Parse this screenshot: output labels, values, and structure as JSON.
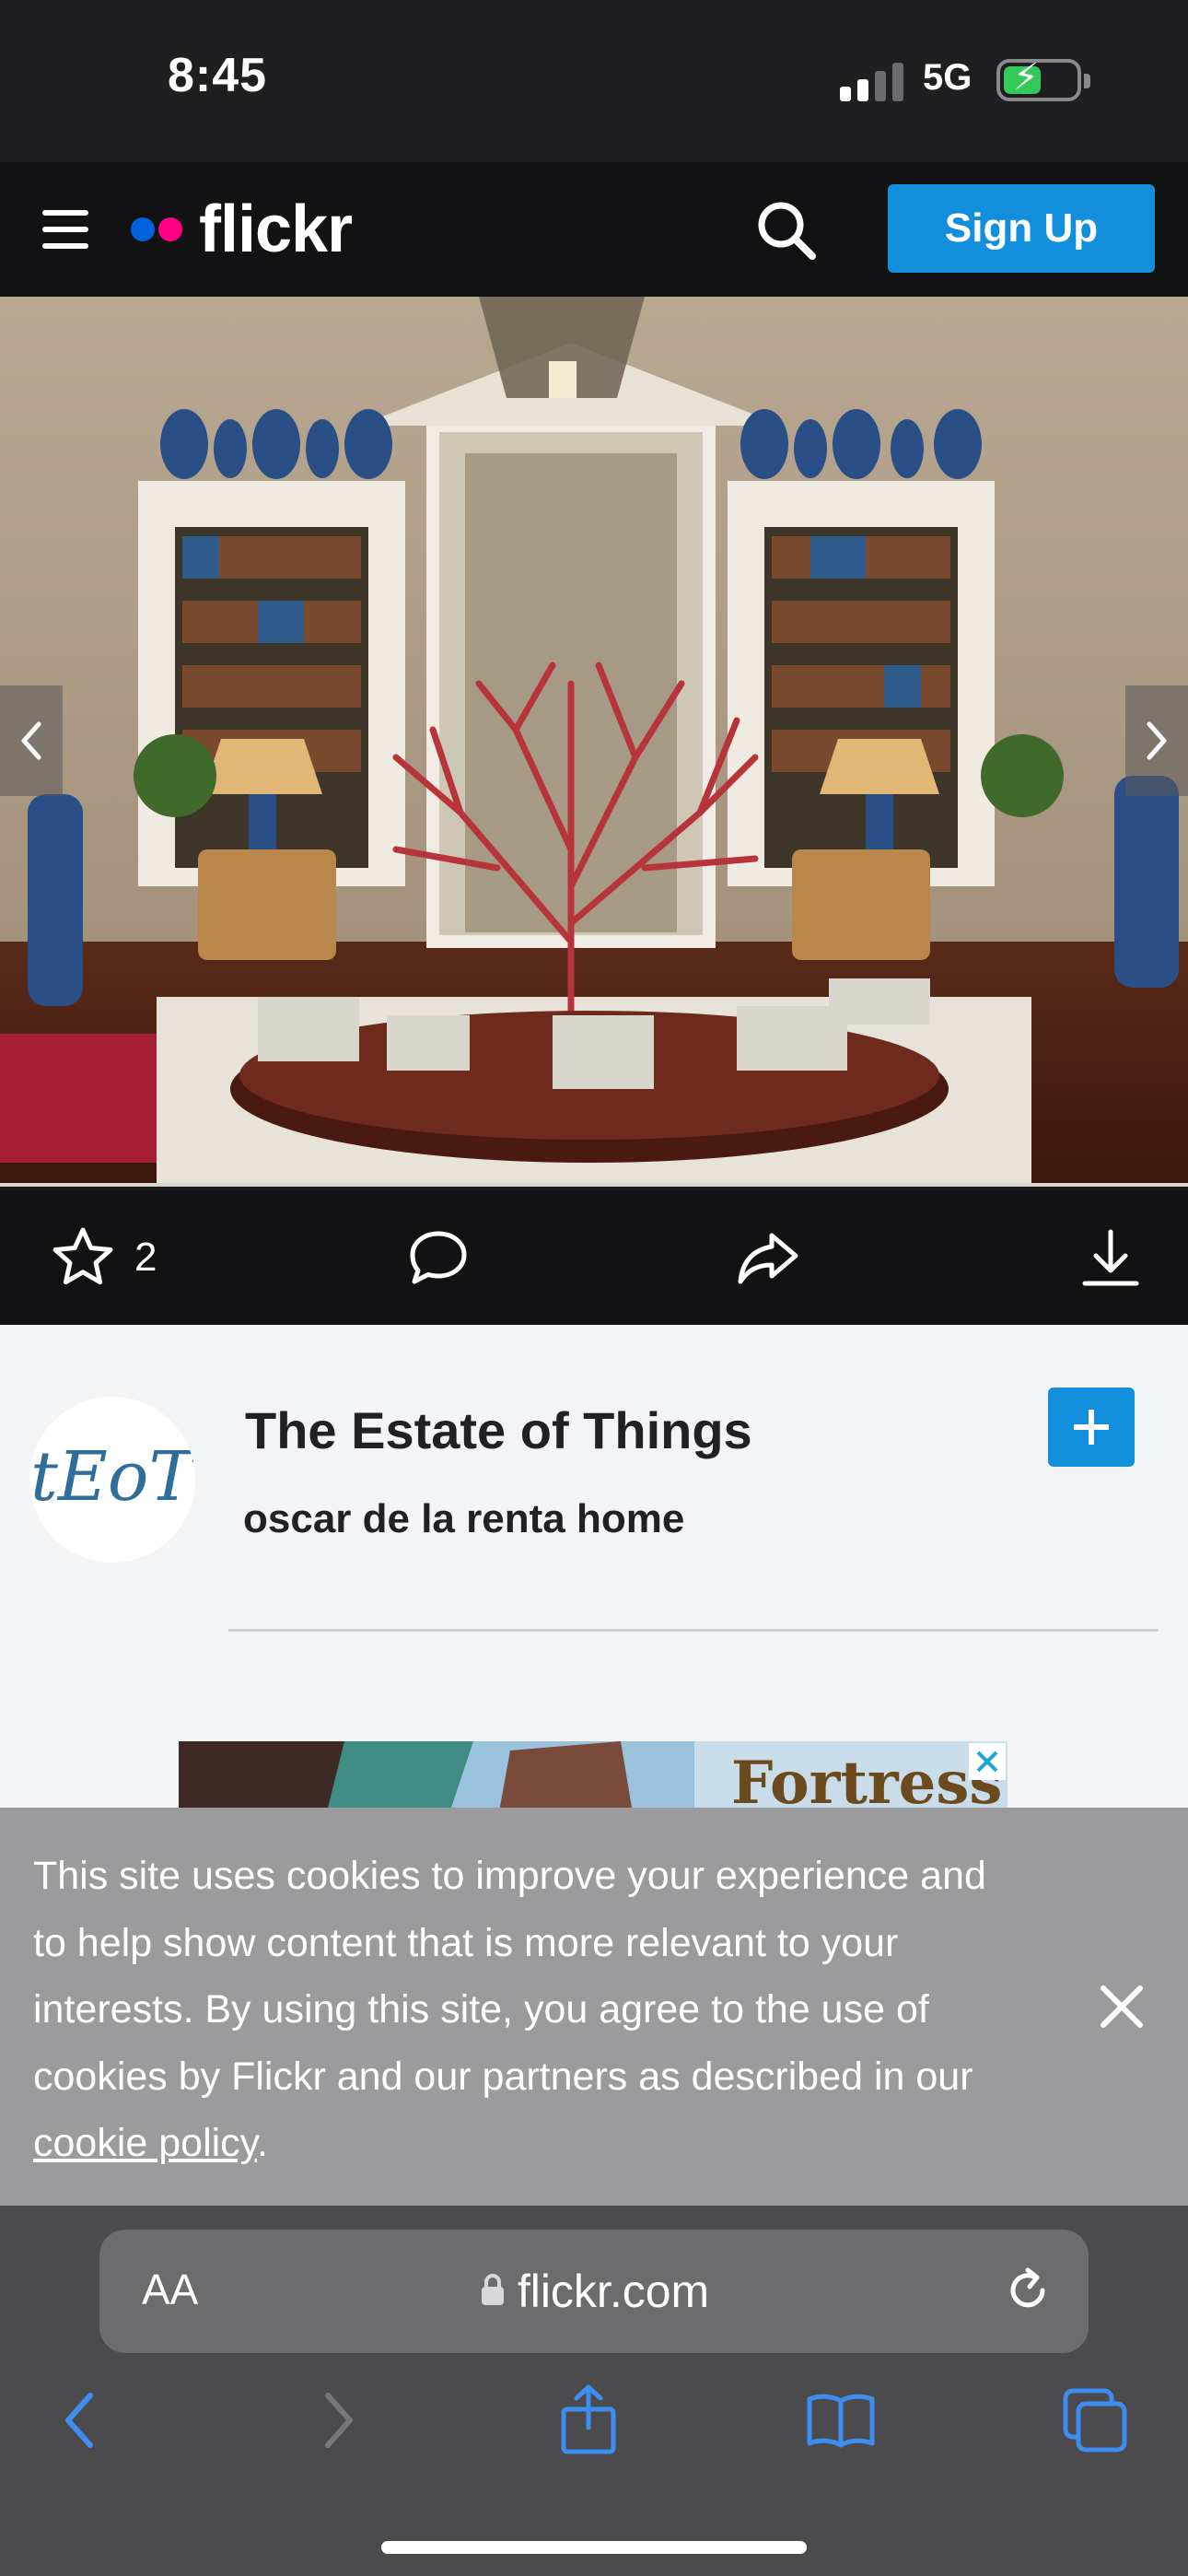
{
  "status_bar": {
    "time": "8:45",
    "network": "5G",
    "icons": [
      "signal-icon",
      "battery-charging-icon"
    ]
  },
  "header": {
    "logo_text": "flickr",
    "logo_colors": {
      "blue": "#0063dc",
      "pink": "#ff0084"
    },
    "signup_label": "Sign Up",
    "icons": [
      "menu-icon",
      "search-icon"
    ]
  },
  "photo": {
    "icons": [
      "chevron-left-icon",
      "chevron-right-icon"
    ]
  },
  "actions": {
    "favorites_count": "2",
    "icons": [
      "star-icon",
      "comment-icon",
      "share-icon",
      "download-icon"
    ]
  },
  "owner": {
    "name": "The Estate of Things",
    "avatar_monogram": "tEoT"
  },
  "photo_info": {
    "title": "oscar de la renta home"
  },
  "ad": {
    "text": "Fortress"
  },
  "cookie": {
    "text_before": "This site uses cookies to improve your experience and to help show content that is more relevant to your interests. By using this site, you agree to the use of cookies by Flickr and our partners as described in our ",
    "link_label": "cookie policy",
    "text_after": "."
  },
  "browser": {
    "aa_label": "AA",
    "url": "flickr.com",
    "icons": [
      "lock-icon",
      "reload-icon",
      "back-icon",
      "forward-icon",
      "share-icon",
      "bookmarks-icon",
      "tabs-icon"
    ]
  },
  "colors": {
    "accent": "#128fdc",
    "header_bg": "#121214",
    "content_bg": "#f3f4f6",
    "banner_bg": "#9b9b9d"
  }
}
